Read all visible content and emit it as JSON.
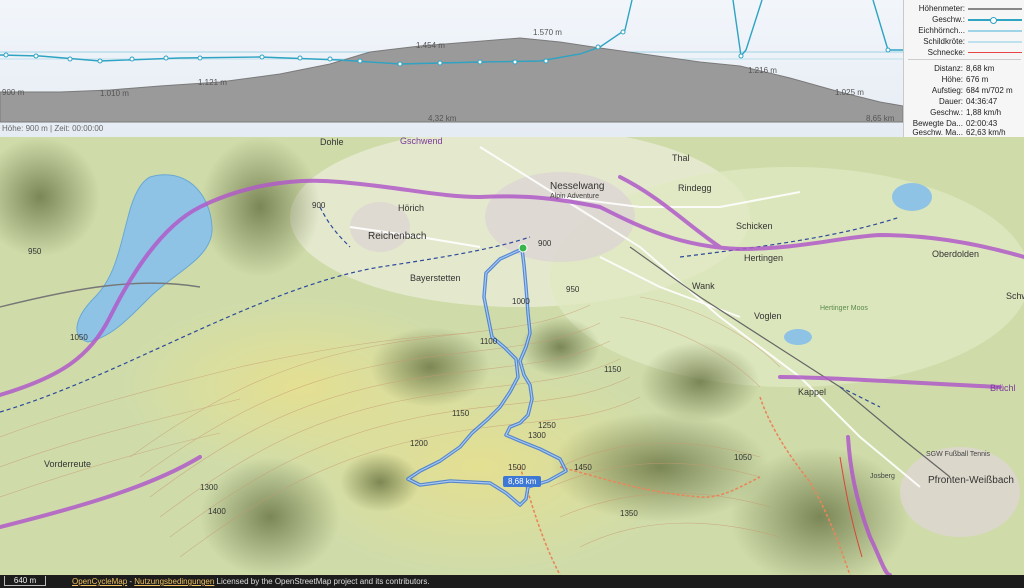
{
  "profile": {
    "elevation_labels": [
      "900 m",
      "1.010 m",
      "1.121 m",
      "1.454 m",
      "1.570 m",
      "1.216 m",
      "1.025 m"
    ],
    "distance_labels": [
      "4,32 km",
      "8,65 km"
    ],
    "status": "Höhe: 900 m | Zeit: 00:00:00"
  },
  "legend": {
    "items": [
      {
        "label": "Höhenmeter:",
        "color": "#888888"
      },
      {
        "label": "Geschw.:",
        "color": "#2ea3c2"
      },
      {
        "label": "Eichhörnch...",
        "color": "#9fd3e6"
      },
      {
        "label": "Schildkröte:",
        "color": "#bfe1ee"
      },
      {
        "label": "Schnecke:",
        "color": "#e64545"
      }
    ]
  },
  "stats": [
    {
      "key": "Distanz:",
      "value": "8,68 km"
    },
    {
      "key": "Höhe:",
      "value": "676 m"
    },
    {
      "key": "Aufstieg:",
      "value": "684 m/702 m"
    },
    {
      "key": "Dauer:",
      "value": "04:36:47"
    },
    {
      "key": "Geschw.:",
      "value": "1,88 km/h"
    },
    {
      "key": "Bewegte Da...",
      "value": "02:00:43"
    },
    {
      "key": "Geschw. Ma...",
      "value": "62,63 km/h"
    }
  ],
  "map": {
    "places": [
      "Dohle",
      "Gschwend",
      "Nesselwang",
      "Alpin Adventure",
      "Thal",
      "Rindegg",
      "Hörich",
      "Reichenbach",
      "Schicken",
      "Hertingen",
      "Oberdolden",
      "Bayerstetten",
      "Wank",
      "Voglen",
      "Hertinger Moos",
      "Kappel",
      "Vorderreute",
      "SGW Fußball Tennis",
      "Pfronten-Weißbach",
      "Josberg",
      "Schw",
      "Brüchl"
    ],
    "elevations": [
      "900",
      "950",
      "1000",
      "1050",
      "1100",
      "1150",
      "1200",
      "1250",
      "1300",
      "1350",
      "1400",
      "1450",
      "1500"
    ],
    "track_distance": "8,68 km"
  },
  "footer": {
    "scale": "640 m",
    "attribution_link1": "OpenCycleMap",
    "attribution_sep": " - ",
    "attribution_link2": "Nutzungsbedingungen",
    "attribution_text": " Licensed by the OpenStreetMap project and its contributors."
  },
  "colors": {
    "track": "#3d78d4",
    "speed_line": "#2ea3c2",
    "elevation_fill": "#9a9a9a",
    "cycle_route": "#b05bc8",
    "lake": "#8ec3e6"
  }
}
